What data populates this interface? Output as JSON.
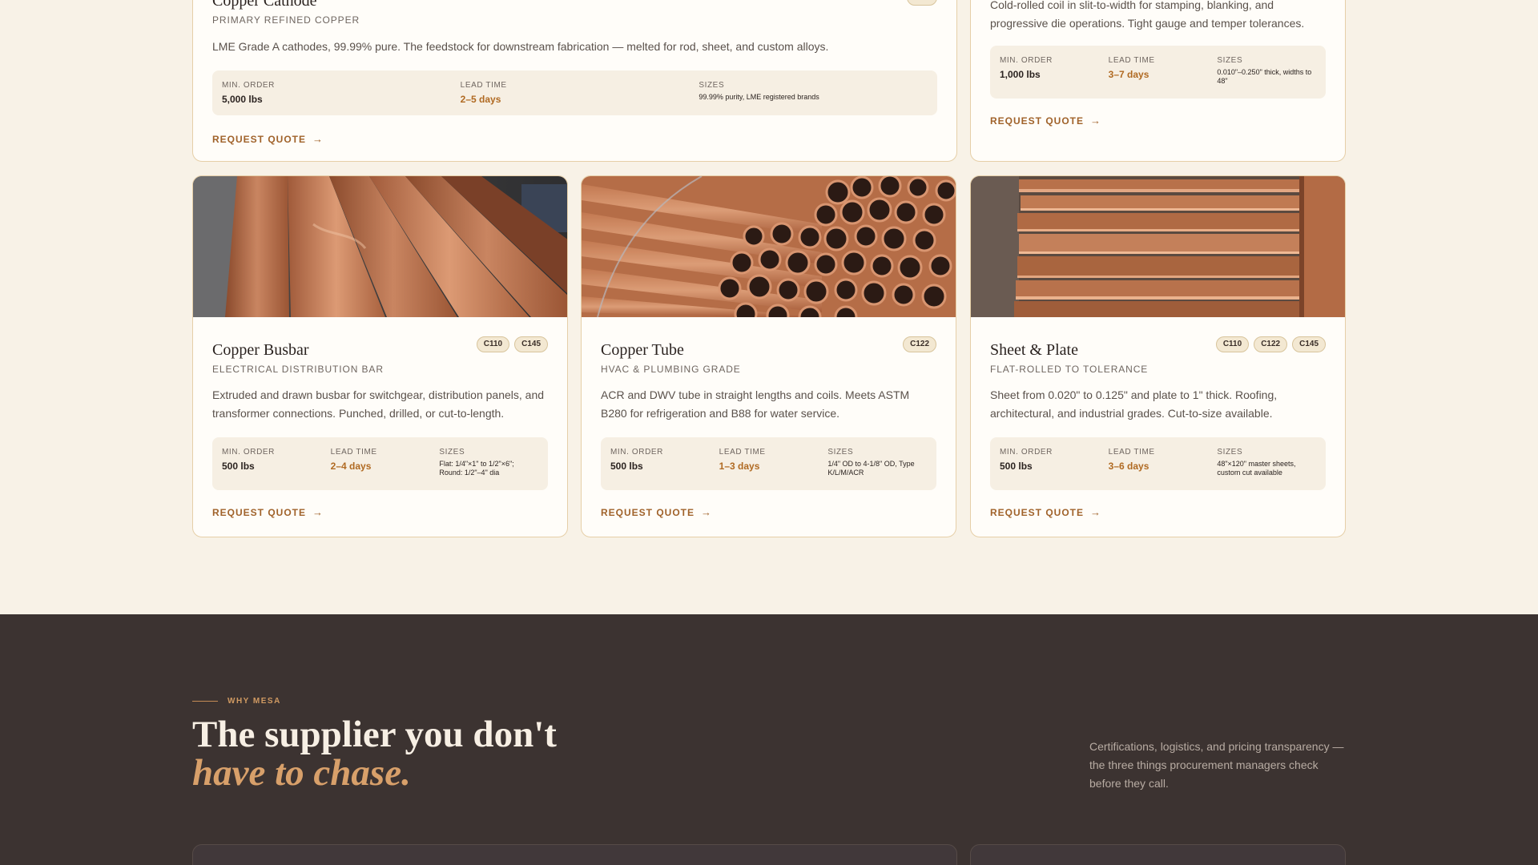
{
  "products": {
    "cathode": {
      "title": "Copper Cathode",
      "subtitle": "Primary Refined Copper",
      "description": "LME Grade A cathodes, 99.99% pure. The feedstock for downstream fabrication — melted for rod, sheet, and custom alloys.",
      "min_order_label": "Min. Order",
      "min_order": "5,000 lbs",
      "lead_time_label": "Lead Time",
      "lead_time": "2–5 days",
      "sizes_label": "Sizes",
      "sizes": "99.99% purity, LME registered brands",
      "cta": "Request Quote"
    },
    "strip": {
      "description": "Cold-rolled coil in slit-to-width for stamping, blanking, and progressive die operations. Tight gauge and temper tolerances.",
      "min_order_label": "Min. Order",
      "min_order": "1,000 lbs",
      "lead_time_label": "Lead Time",
      "lead_time": "3–7 days",
      "sizes_label": "Sizes",
      "sizes": "0.010\"–0.250\" thick, widths to 48\"",
      "cta": "Request Quote"
    },
    "busbar": {
      "title": "Copper Busbar",
      "subtitle": "Electrical Distribution Bar",
      "badges": [
        "C110",
        "C145"
      ],
      "description": "Extruded and drawn busbar for switchgear, distribution panels, and transformer connections. Punched, drilled, or cut-to-length.",
      "min_order_label": "Min. Order",
      "min_order": "500 lbs",
      "lead_time_label": "Lead Time",
      "lead_time": "2–4 days",
      "sizes_label": "Sizes",
      "sizes": "Flat: 1/4\"×1\" to 1/2\"×6\"; Round: 1/2\"–4\" dia",
      "cta": "Request Quote"
    },
    "tube": {
      "title": "Copper Tube",
      "subtitle": "HVAC & Plumbing Grade",
      "badges": [
        "C122"
      ],
      "description": "ACR and DWV tube in straight lengths and coils. Meets ASTM B280 for refrigeration and B88 for water service.",
      "min_order_label": "Min. Order",
      "min_order": "500 lbs",
      "lead_time_label": "Lead Time",
      "lead_time": "1–3 days",
      "sizes_label": "Sizes",
      "sizes": "1/4\" OD to 4-1/8\" OD, Type K/L/M/ACR",
      "cta": "Request Quote"
    },
    "sheet": {
      "title": "Sheet & Plate",
      "subtitle": "Flat-Rolled to Tolerance",
      "badges": [
        "C110",
        "C122",
        "C145"
      ],
      "description": "Sheet from 0.020\" to 0.125\" and plate to 1\" thick. Roofing, architectural, and industrial grades. Cut-to-size available.",
      "min_order_label": "Min. Order",
      "min_order": "500 lbs",
      "lead_time_label": "Lead Time",
      "lead_time": "3–6 days",
      "sizes_label": "Sizes",
      "sizes": "48\"×120\" master sheets, custom cut available",
      "cta": "Request Quote"
    }
  },
  "why": {
    "eyebrow": "WHY MESA",
    "headline": "The supplier you don't",
    "headline_accent": "have to chase.",
    "note": "Certifications, logistics, and pricing transparency — the three things procurement managers check before they call."
  },
  "colors": {
    "page_bg": "#f8f2e7",
    "card_border": "#e6cfa8",
    "accent": "#b06a22",
    "dark_section": "#3c3331",
    "headline_accent": "#d8a06a"
  },
  "icons": {
    "cta_arrow": "→"
  }
}
